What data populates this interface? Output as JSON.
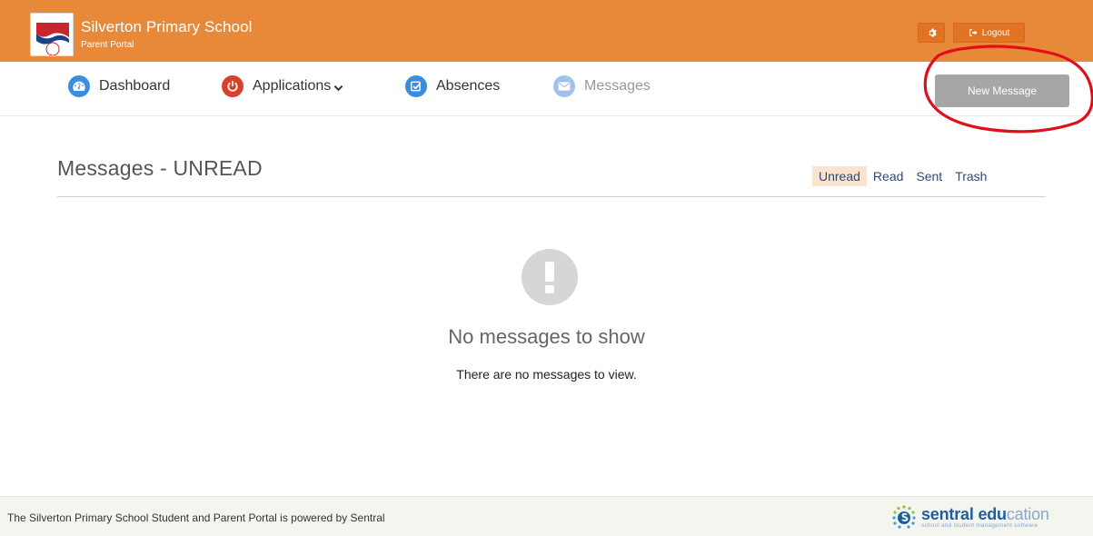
{
  "header": {
    "school_name": "Silverton Primary School",
    "portal_name": "Parent Portal",
    "settings_icon": "gear-icon",
    "logout_label": "Logout",
    "logout_icon": "sign-out-icon",
    "background_color": "#e8893a"
  },
  "nav": {
    "items": [
      {
        "label": "Dashboard",
        "icon": "dashboard-icon",
        "color": "#3b8de0"
      },
      {
        "label": "Applications",
        "icon": "power-icon",
        "color": "#d9412d",
        "dropdown": true
      },
      {
        "label": "Absences",
        "icon": "check-square-icon",
        "color": "#3b8de0"
      },
      {
        "label": "Messages",
        "icon": "envelope-icon",
        "color": "#9fc1ea",
        "active": true
      }
    ],
    "new_message_label": "New Message"
  },
  "messages": {
    "title": "Messages - UNREAD",
    "tabs": [
      {
        "label": "Unread",
        "active": true
      },
      {
        "label": "Read"
      },
      {
        "label": "Sent"
      },
      {
        "label": "Trash"
      }
    ],
    "empty_heading": "No messages to show",
    "empty_text": "There are no messages to view.",
    "empty_icon": "exclamation-icon"
  },
  "footer": {
    "text": "The Silverton Primary School Student and Parent Portal is powered by Sentral",
    "brand_bold": "sentral",
    "brand_edu": "edu",
    "brand_cation": "cation",
    "brand_tagline": "school and student management software"
  }
}
